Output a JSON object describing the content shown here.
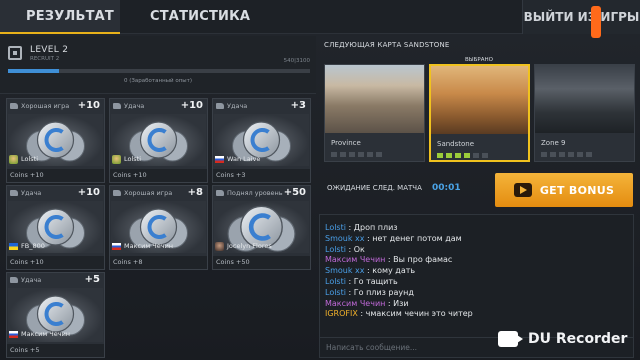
{
  "tabs": [
    {
      "label": "РЕЗУЛЬТАТ"
    },
    {
      "label": "СТАТИСТИКА"
    }
  ],
  "exit_label": "ВЫЙТИ ИЗ ИГРЫ",
  "level": {
    "title": "LEVEL 2",
    "sub": "RECRUIT 2",
    "xp": "540|3100",
    "note": "0 (Заработанный опыт)",
    "progress": 0.17
  },
  "cards": [
    {
      "type": "Хорошая игра",
      "value": "+10",
      "user": "Lolsti",
      "flag": "avatar-green",
      "reward": "Coins +10"
    },
    {
      "type": "Удача",
      "value": "+10",
      "user": "Lolsti",
      "flag": "avatar-green",
      "reward": "Coins +10"
    },
    {
      "type": "Удача",
      "value": "+3",
      "user": "Wan Laive",
      "flag": "ru",
      "reward": "Coins +3"
    },
    {
      "type": "Удача",
      "value": "+10",
      "user": "FB_800",
      "flag": "ua",
      "reward": "Coins +10"
    },
    {
      "type": "Хорошая игра",
      "value": "+8",
      "user": "Максим Чечин",
      "flag": "ru",
      "reward": "Coins +8"
    },
    {
      "type": "Поднял уровень",
      "value": "+50",
      "user": "Jocelyn Flores",
      "flag": "avatar-dark",
      "reward": "Coins +50"
    },
    {
      "type": "Удача",
      "value": "+5",
      "user": "Максим Чечин",
      "flag": "ru",
      "reward": "Coins +5"
    }
  ],
  "next_map_title": "СЛЕДУЮЩАЯ КАРТА SANDSTONE",
  "chosen_label": "ВЫБРАНО",
  "maps": [
    {
      "name": "Province",
      "votes": 0,
      "selected": false
    },
    {
      "name": "Sandstone",
      "votes": 4,
      "selected": true
    },
    {
      "name": "Zone 9",
      "votes": 0,
      "selected": false
    }
  ],
  "wait_label": "ОЖИДАНИЕ СЛЕД. МАТЧА",
  "timer": "00:01",
  "bonus_label": "GET BONUS",
  "chat": [
    {
      "name": "Lolsti",
      "color": "blue",
      "text": ": Дроп плиз"
    },
    {
      "name": "Smouk xx",
      "color": "blue",
      "text": ": нет денег потом дам"
    },
    {
      "name": "Lolsti",
      "color": "blue",
      "text": ": Ок"
    },
    {
      "name": "Максим Чечин",
      "color": "purple",
      "text": ": Вы про фамас"
    },
    {
      "name": "Smouk xx",
      "color": "blue",
      "text": ": кому дать"
    },
    {
      "name": "Lolsti",
      "color": "blue",
      "text": ": Го тащить"
    },
    {
      "name": "Lolsti",
      "color": "blue",
      "text": ": Го плиз раунд"
    },
    {
      "name": "Максим Чечин",
      "color": "purple",
      "text": ": Изи"
    },
    {
      "name": "IGROFIX",
      "color": "orange",
      "text": ": чмаксим чечин это читер"
    }
  ],
  "chat_placeholder": "Написать сообщение...",
  "recorder_label": "DU Recorder",
  "colors": {
    "accent": "#f0c21e",
    "bonus": "#e48c10",
    "blue_name": "#4a9fe8",
    "purple_name": "#c069d8",
    "orange_name": "#f0b02a"
  }
}
